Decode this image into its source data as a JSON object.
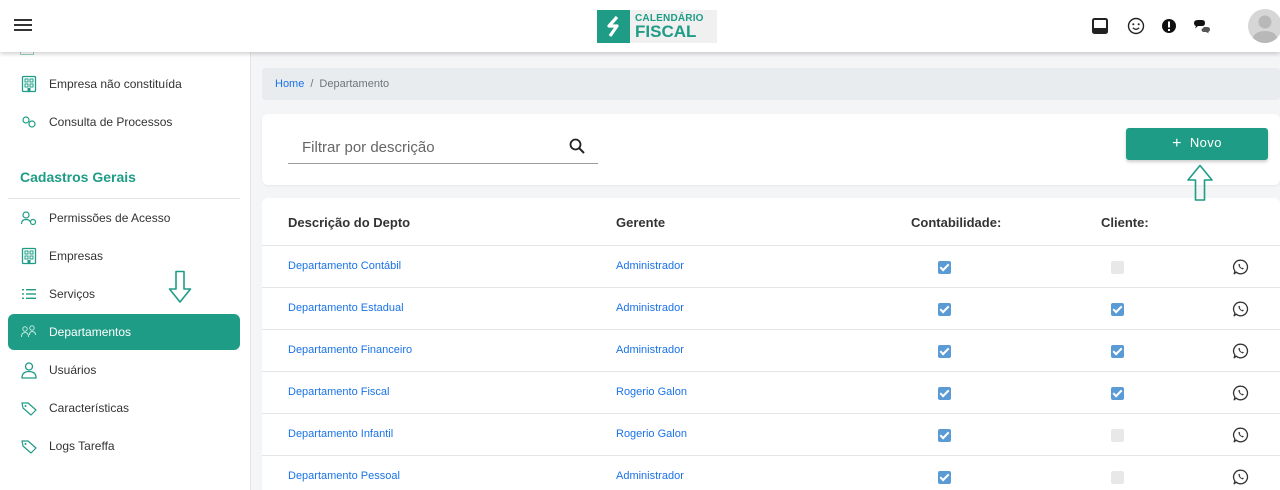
{
  "header": {
    "logo_line1": "CALENDÁRIO",
    "logo_line2": "FISCAL",
    "icons": [
      "inbox-icon",
      "smiley-icon",
      "alert-icon",
      "chat-icon",
      "avatar"
    ]
  },
  "sidebar": {
    "items_top": [
      {
        "label": "Empresa não constituída",
        "icon": "building-icon"
      },
      {
        "label": "Consulta de Processos",
        "icon": "process-icon"
      }
    ],
    "section_title": "Cadastros Gerais",
    "items": [
      {
        "label": "Permissões de Acesso",
        "icon": "users-key-icon"
      },
      {
        "label": "Empresas",
        "icon": "building-icon"
      },
      {
        "label": "Serviços",
        "icon": "list-icon"
      },
      {
        "label": "Departamentos",
        "icon": "group-icon",
        "active": true
      },
      {
        "label": "Usuários",
        "icon": "user-icon"
      },
      {
        "label": "Características",
        "icon": "tag-icon"
      },
      {
        "label": "Logs Tareffa",
        "icon": "tag-icon"
      }
    ]
  },
  "breadcrumb": {
    "home": "Home",
    "separator": "/",
    "current": "Departamento"
  },
  "filter": {
    "placeholder": "Filtrar por descrição",
    "value": ""
  },
  "actions": {
    "new_plus": "+",
    "new_label": "Novo"
  },
  "table": {
    "columns": [
      "Descrição do Depto",
      "Gerente",
      "Contabilidade:",
      "Cliente:"
    ],
    "rows": [
      {
        "descricao": "Departamento Contábil",
        "gerente": "Administrador",
        "contabilidade": true,
        "cliente": false
      },
      {
        "descricao": "Departamento Estadual",
        "gerente": "Administrador",
        "contabilidade": true,
        "cliente": true
      },
      {
        "descricao": "Departamento Financeiro",
        "gerente": "Administrador",
        "contabilidade": true,
        "cliente": true
      },
      {
        "descricao": "Departamento Fiscal",
        "gerente": "Rogerio Galon",
        "contabilidade": true,
        "cliente": true
      },
      {
        "descricao": "Departamento Infantil",
        "gerente": "Rogerio Galon",
        "contabilidade": true,
        "cliente": false
      },
      {
        "descricao": "Departamento Pessoal",
        "gerente": "Administrador",
        "contabilidade": true,
        "cliente": false
      }
    ]
  },
  "colors": {
    "accent": "#1f9c86",
    "link": "#1a73e8",
    "checkbox_on": "#5b9bd5",
    "checkbox_off": "#e8e8e8"
  }
}
